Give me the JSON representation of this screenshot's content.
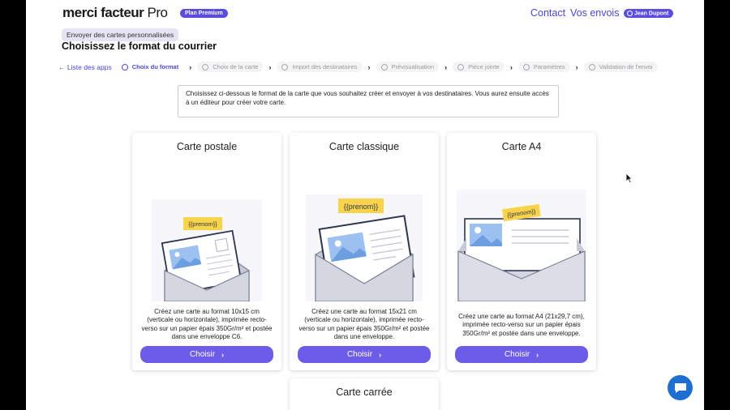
{
  "header": {
    "logo_main": "merci facteur",
    "logo_suffix": " Pro",
    "plan_badge": "Plan Premium",
    "nav": [
      "Contact",
      "Vos envois"
    ],
    "user": "Jean Dupont"
  },
  "breadcrumb_chip": "Envoyer des cartes personnalisées",
  "page_title": "Choisissez le format du courrier",
  "stepper": {
    "back": "Liste des apps",
    "steps": [
      "Choix du format",
      "Choix de la carte",
      "Import des destinataires",
      "Prévisualisation",
      "Pièce jointe",
      "Paramètres",
      "Validation de l'envoi"
    ],
    "active_index": 0
  },
  "info_text": "Choisissez ci-dessous le format de la carte que vous souhaitez créer et envoyer à vos destinataires. Vous aurez ensuite accès à un éditeur pour créer votre carte.",
  "placeholder_tag": "{{prenom}}",
  "cards": [
    {
      "title": "Carte postale",
      "description": "Créez une carte au format 10x15 cm (verticale ou horizontale), imprimée recto-verso sur un papier épais 350Gr/m² et postée dans une enveloppe C6.",
      "button": "Choisir"
    },
    {
      "title": "Carte classique",
      "description": "Créez une carte au format 15x21 cm (verticale ou horizontale), imprimée recto-verso sur un papier épais 350Gr/m² et postée dans une enveloppe.",
      "button": "Choisir"
    },
    {
      "title": "Carte A4",
      "description": "Créez une carte au format A4 (21x29,7 cm), imprimée recto-verso sur un papier épais 350Gr/m² et postée dans une enveloppe.",
      "button": "Choisir"
    },
    {
      "title": "Carte carrée"
    }
  ],
  "colors": {
    "accent": "#4a47d9",
    "button": "#6d5ce8",
    "badge": "#5b4ce0",
    "chat": "#1f6fd1"
  }
}
